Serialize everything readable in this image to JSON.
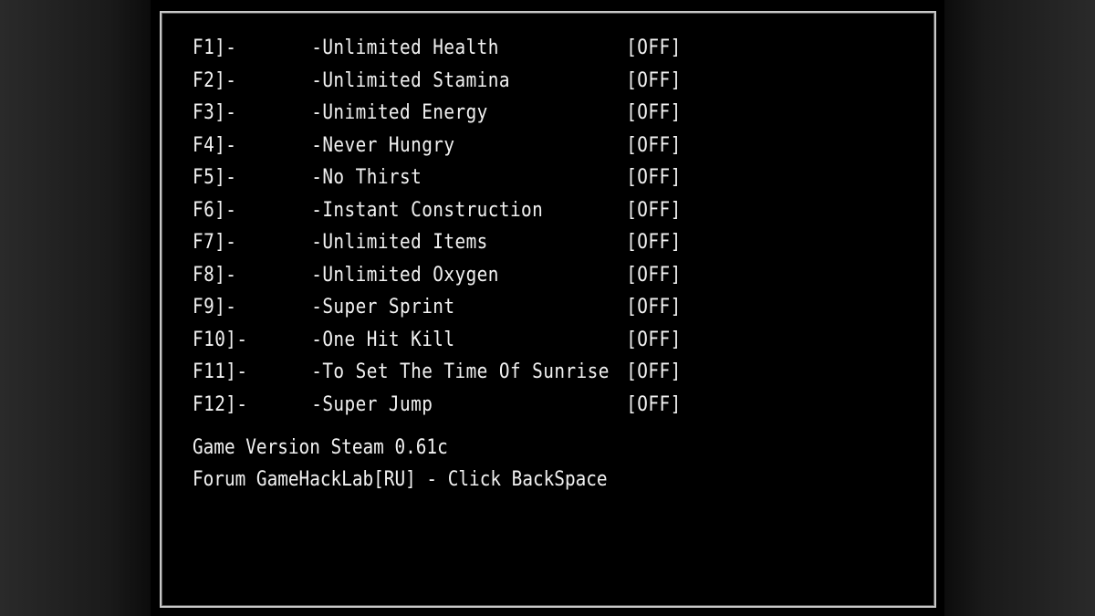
{
  "trainer": {
    "options": [
      {
        "hotkey": "F1]-",
        "label": "-Unlimited Health",
        "state": "[OFF]"
      },
      {
        "hotkey": "F2]-",
        "label": "-Unlimited Stamina",
        "state": "[OFF]"
      },
      {
        "hotkey": "F3]-",
        "label": "-Unimited Energy",
        "state": "[OFF]"
      },
      {
        "hotkey": "F4]-",
        "label": "-Never Hungry",
        "state": "[OFF]"
      },
      {
        "hotkey": "F5]-",
        "label": "-No Thirst",
        "state": "[OFF]"
      },
      {
        "hotkey": "F6]-",
        "label": "-Instant Construction",
        "state": "[OFF]"
      },
      {
        "hotkey": "F7]-",
        "label": "-Unlimited Items",
        "state": "[OFF]"
      },
      {
        "hotkey": "F8]-",
        "label": "-Unlimited Oxygen",
        "state": "[OFF]"
      },
      {
        "hotkey": "F9]-",
        "label": "-Super Sprint",
        "state": "[OFF]"
      },
      {
        "hotkey": "F10]-",
        "label": "-One Hit Kill",
        "state": "[OFF]"
      },
      {
        "hotkey": "F11]-",
        "label": "-To Set The Time Of Sunrise",
        "state": "[OFF]"
      },
      {
        "hotkey": "F12]-",
        "label": "-Super Jump",
        "state": "[OFF]"
      }
    ],
    "footer": {
      "version": "Game Version Steam 0.61c",
      "forum": "Forum GameHackLab[RU] - Click BackSpace"
    }
  },
  "colors": {
    "text": "#f2f2f2",
    "panel_bg": "#000000",
    "border": "#c8c8c8"
  }
}
